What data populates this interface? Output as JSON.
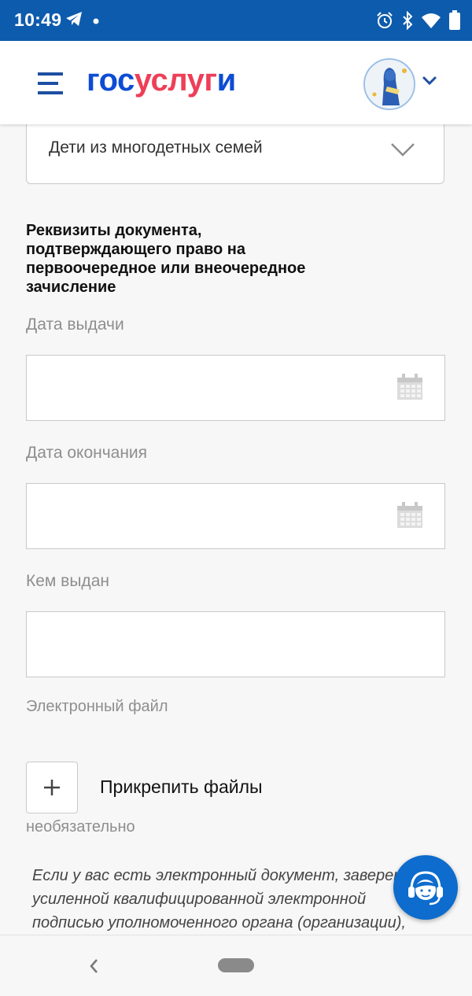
{
  "status_bar": {
    "time": "10:49",
    "left_icons": [
      "telegram-icon",
      "dot-icon"
    ],
    "right_icons": [
      "alarm-icon",
      "bluetooth-icon",
      "wifi-icon",
      "battery-icon"
    ]
  },
  "header": {
    "logo_part1": "гос",
    "logo_part2": "услуг",
    "logo_part3": "и",
    "brand_blue": "#0d4cd3",
    "brand_red": "#ee3f58"
  },
  "form": {
    "category_select": {
      "value": "Дети из многодетных семей"
    },
    "section_title": "Реквизиты документа, подтверждающего право на первоочередное или внеочередное зачисление",
    "fields": [
      {
        "label": "Дата выдачи",
        "value": ""
      },
      {
        "label": "Дата окончания",
        "value": ""
      },
      {
        "label": "Кем выдан",
        "value": ""
      }
    ],
    "file_label": "Электронный файл",
    "attach_label": "Прикрепить файлы",
    "optional_label": "необязательно",
    "hint_lines": [
      "Если у вас есть электронный документ, заверен",
      "усиленной квалифицированной электронной",
      "подписью уполномоченного органа (организации),"
    ]
  },
  "colors": {
    "status_bar": "#0d5bad",
    "support_button": "#0d6ccd"
  }
}
